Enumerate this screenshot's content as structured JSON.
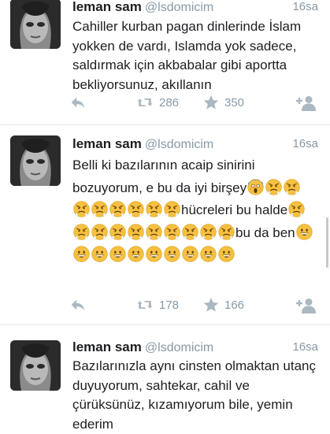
{
  "tweets": [
    {
      "name": "leman sam",
      "handle": "@lsdomicim",
      "time": "16sa",
      "text": "Cahiller kurban pagan dinlerinde İslam yokken de vardı, Islamda yok sadece, saldırmak için akbabalar gibi aportta bekliyorsunuz, akıllanın",
      "retweets": "286",
      "favorites": "350"
    },
    {
      "name": "leman sam",
      "handle": "@lsdomicim",
      "time": "16sa",
      "text_parts": [
        "Belli ki bazılarının acaip sinirini bozuyorum, e bu da iyi birşey",
        "hücreleri bu halde",
        "bu da ben"
      ],
      "emoji_names": [
        "screaming-face-emoji",
        "pouting-face-emoji",
        "grinning-face-emoji"
      ],
      "retweets": "178",
      "favorites": "166"
    },
    {
      "name": "leman sam",
      "handle": "@lsdomicim",
      "time": "16sa",
      "text": "Bazılarınızla aynı cinsten olmaktan utanç duyuyorum, sahtekar, cahil ve çürüksünüz, kızamıyorum bile, yemin ederim"
    }
  ],
  "icons": {
    "reply": "reply-arrow-icon",
    "retweet": "retweet-icon",
    "favorite": "star-icon",
    "follow": "follow-user-icon"
  },
  "colors": {
    "icon_gray": "#aab8c2",
    "text_gray": "#8899a6",
    "divider": "#e1e8ed"
  }
}
